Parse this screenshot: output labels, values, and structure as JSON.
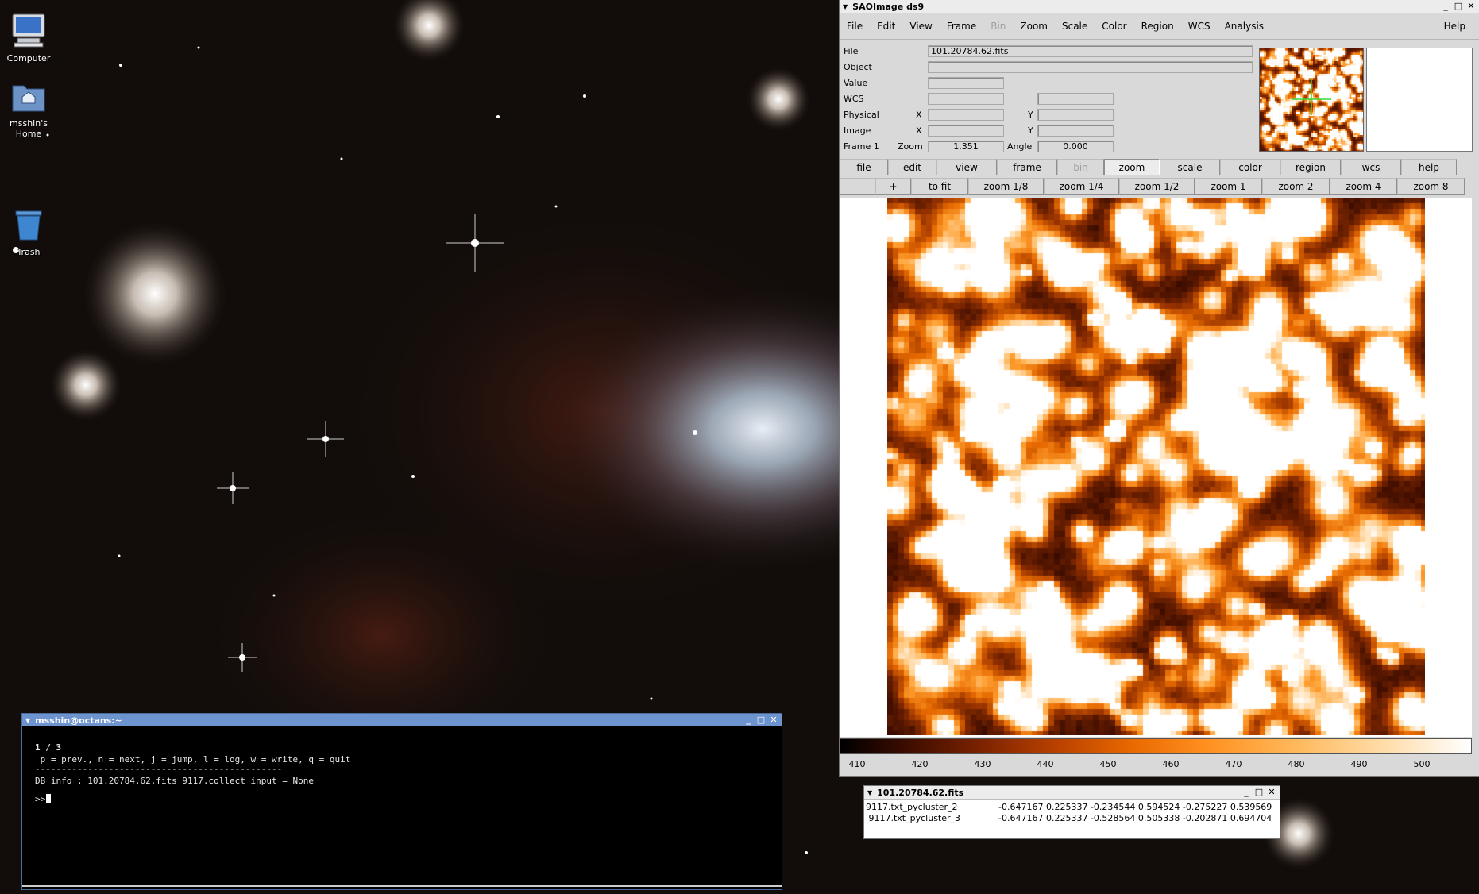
{
  "desktop": {
    "icons": [
      {
        "label": "Computer",
        "icon": "computer-icon"
      },
      {
        "label": "msshin's Home",
        "icon": "home-folder-icon"
      },
      {
        "label": "Trash",
        "icon": "trash-icon"
      }
    ]
  },
  "ds9": {
    "title": "SAOImage ds9",
    "menu": [
      "File",
      "Edit",
      "View",
      "Frame",
      "Bin",
      "Zoom",
      "Scale",
      "Color",
      "Region",
      "WCS",
      "Analysis"
    ],
    "menu_disabled": [
      "Bin"
    ],
    "help_menu": "Help",
    "info": {
      "file_label": "File",
      "file_value": "101.20784.62.fits",
      "object_label": "Object",
      "value_label": "Value",
      "wcs_label": "WCS",
      "physical_label": "Physical",
      "image_label": "Image",
      "frame_label": "Frame 1",
      "x_label": "X",
      "y_label": "Y",
      "zoom_label": "Zoom",
      "zoom_value": "1.351",
      "angle_label": "Angle",
      "angle_value": "0.000"
    },
    "buttonbar_top": [
      "file",
      "edit",
      "view",
      "frame",
      "bin",
      "zoom",
      "scale",
      "color",
      "region",
      "wcs",
      "help"
    ],
    "buttonbar_top_selected": "zoom",
    "buttonbar_top_disabled": "bin",
    "buttonbar_zoom": [
      "-",
      "+",
      "to fit",
      "zoom 1/8",
      "zoom 1/4",
      "zoom 1/2",
      "zoom 1",
      "zoom 2",
      "zoom 4",
      "zoom 8"
    ],
    "colorbar": {
      "ticks": [
        "410",
        "420",
        "430",
        "440",
        "450",
        "460",
        "470",
        "480",
        "490",
        "500"
      ]
    }
  },
  "fits_window": {
    "title": "101.20784.62.fits",
    "rows": [
      {
        "name": "9117.txt_pycluster_2",
        "values": "-0.647167 0.225337 -0.234544 0.594524 -0.275227 0.539569"
      },
      {
        "name": " 9117.txt_pycluster_3",
        "values": "-0.647167 0.225337 -0.528564 0.505338 -0.202871 0.694704"
      }
    ]
  },
  "terminal": {
    "title": "msshin@octans:~",
    "lines": [
      "1 / 3",
      " p = prev., n = next, j = jump, l = log, w = write, q = quit",
      "-----------------------------------------------",
      "DB info : 101.20784.62.fits 9117.collect input = None",
      ">>"
    ]
  }
}
